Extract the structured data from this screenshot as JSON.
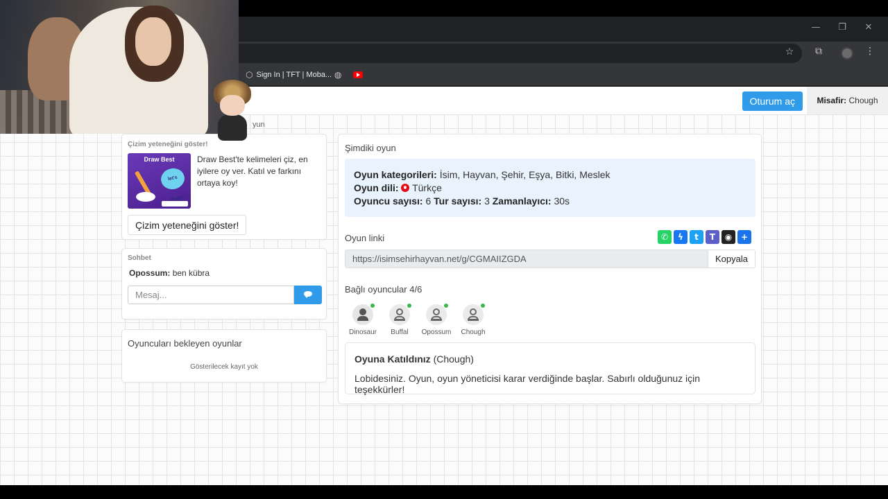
{
  "browser": {
    "window_controls": [
      "—",
      "❐",
      "✕"
    ],
    "bookmarks": [
      {
        "label": "Sign In | TFT | Moba...",
        "icon": "tft-icon"
      },
      {
        "label": "",
        "icon": "globe-icon"
      },
      {
        "label": "",
        "icon": "youtube-icon"
      }
    ]
  },
  "topnav": {
    "login_label": "Oturum aç",
    "guest_label": "Misafir:",
    "guest_name": "Chough"
  },
  "partial_heading": "yun",
  "ad": {
    "title": "Çizim yeteneğini göster!",
    "image_text": "Draw Best",
    "image_bubble": "let's draw!",
    "description": "Draw Best'te kelimeleri çiz, en iyilere oy ver. Katıl ve farkını ortaya koy!",
    "button": "Çizim yeteneğini göster!"
  },
  "chat": {
    "title": "Sohbet",
    "messages": [
      {
        "user": "Opossum:",
        "text": "ben kübra"
      }
    ],
    "placeholder": "Mesaj..."
  },
  "waiting": {
    "title": "Oyuncuları bekleyen oyunlar",
    "empty": "Gösterilecek kayıt yok"
  },
  "game": {
    "title": "Şimdiki oyun",
    "categories_label": "Oyun kategorileri:",
    "categories": "İsim, Hayvan, Şehir, Eşya, Bitki, Meslek",
    "language_label": "Oyun dili:",
    "language": "Türkçe",
    "players_label": "Oyuncu sayısı:",
    "players": "6",
    "rounds_label": "Tur sayısı:",
    "rounds": "3",
    "timer_label": "Zamanlayıcı:",
    "timer": "30s",
    "link_label": "Oyun linki",
    "link": "https://isimsehirhayvan.net/g/CGMAIIZGDA",
    "copy": "Kopyala",
    "connected_label": "Bağlı oyuncular 4/6",
    "connected_players": [
      "Dinosaur",
      "Buffal",
      "Opossum",
      "Chough"
    ],
    "joined_title": "Oyuna Katıldınız",
    "joined_name": "(Chough)",
    "joined_message": "Lobidesiniz. Oyun, oyun yöneticisi karar verdiğinde başlar. Sabırlı olduğunuz için teşekkürler!"
  },
  "share": [
    {
      "name": "whatsapp",
      "color": "#25d366",
      "glyph": "✆"
    },
    {
      "name": "messenger",
      "color": "#1877f2",
      "glyph": "ϟ"
    },
    {
      "name": "twitter",
      "color": "#1da1f2",
      "glyph": "t"
    },
    {
      "name": "teams",
      "color": "#5b5fc7",
      "glyph": "T"
    },
    {
      "name": "snapchat",
      "color": "#222222",
      "glyph": "◉"
    },
    {
      "name": "more",
      "color": "#1a73e8",
      "glyph": "+"
    }
  ],
  "colors": {
    "accent": "#2f9be9",
    "info_bg": "#e8f3fd",
    "online": "#3cb54a"
  }
}
